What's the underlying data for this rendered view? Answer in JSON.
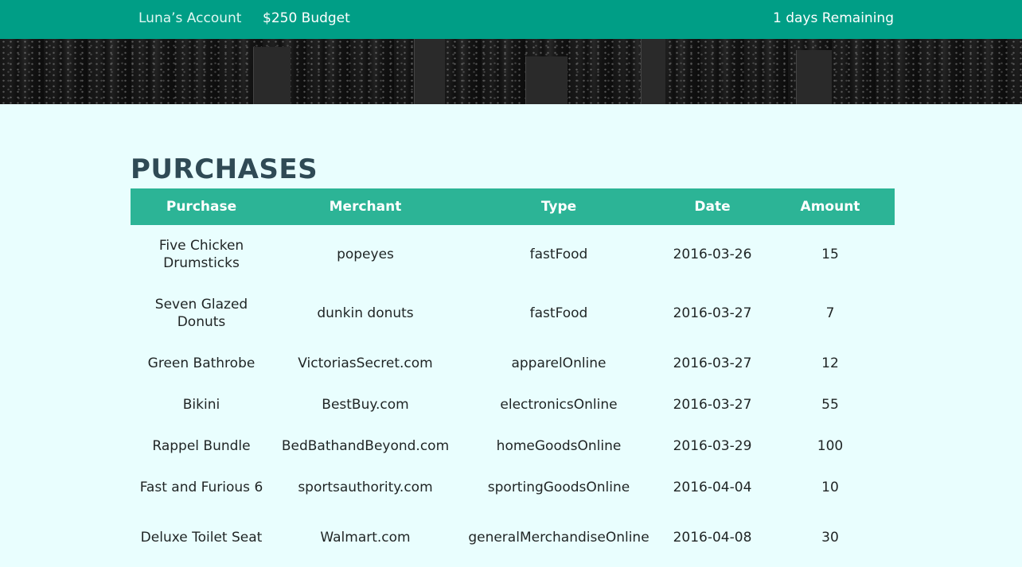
{
  "header": {
    "account": "Luna’s Account",
    "budget": "$250 Budget",
    "remaining": "1 days Remaining"
  },
  "colors": {
    "topbar": "#009e86",
    "table_header": "#2cb496",
    "page_background": "#e9fefe",
    "title": "#2f4a55"
  },
  "banner": {
    "image": "city-skyline-night"
  },
  "purchases": {
    "title": "PURCHASES",
    "columns": [
      "Purchase",
      "Merchant",
      "Type",
      "Date",
      "Amount"
    ],
    "rows": [
      {
        "purchase": "Five Chicken Drumsticks",
        "merchant": "popeyes",
        "type": "fastFood",
        "date": "2016-03-26",
        "amount": "15"
      },
      {
        "purchase": "Seven Glazed Donuts",
        "merchant": "dunkin donuts",
        "type": "fastFood",
        "date": "2016-03-27",
        "amount": "7"
      },
      {
        "purchase": "Green Bathrobe",
        "merchant": "VictoriasSecret.com",
        "type": "apparelOnline",
        "date": "2016-03-27",
        "amount": "12"
      },
      {
        "purchase": "Bikini",
        "merchant": "BestBuy.com",
        "type": "electronicsOnline",
        "date": "2016-03-27",
        "amount": "55"
      },
      {
        "purchase": "Rappel Bundle",
        "merchant": "BedBathandBeyond.com",
        "type": "homeGoodsOnline",
        "date": "2016-03-29",
        "amount": "100"
      },
      {
        "purchase": "Fast and Furious 6",
        "merchant": "sportsauthority.com",
        "type": "sportingGoodsOnline",
        "date": "2016-04-04",
        "amount": "10"
      },
      {
        "purchase": "Deluxe Toilet Seat",
        "merchant": "Walmart.com",
        "type": "generalMerchandiseOnline",
        "date": "2016-04-08",
        "amount": "30"
      }
    ]
  }
}
